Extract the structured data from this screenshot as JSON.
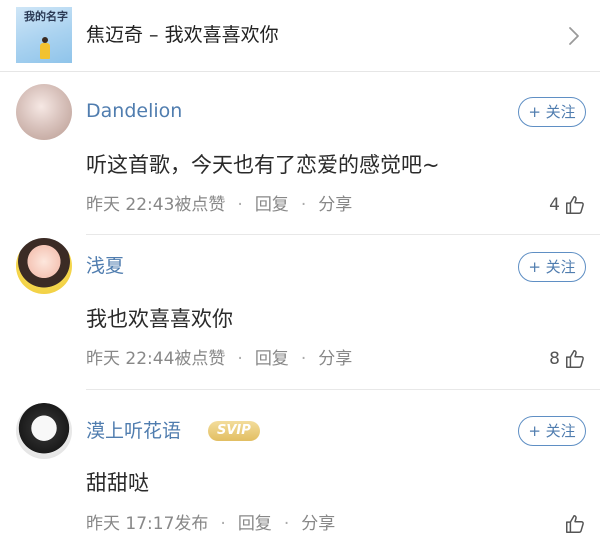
{
  "song": {
    "title": "焦迈奇 – 我欢喜喜欢你",
    "cover_text": "我的名字"
  },
  "comments": [
    {
      "username": "Dandelion",
      "text": "听这首歌，今天也有了恋爱的感觉吧~",
      "time": "昨天 22:43",
      "status": "被点赞",
      "reply_label": "回复",
      "share_label": "分享",
      "likes": "4",
      "follow_label": "+ 关注"
    },
    {
      "username": "浅夏",
      "text": "我也欢喜喜欢你",
      "time": "昨天 22:44",
      "status": "被点赞",
      "reply_label": "回复",
      "share_label": "分享",
      "likes": "8",
      "follow_label": "+ 关注"
    },
    {
      "username": "漠上听花语",
      "badge": "SVIP",
      "text": "甜甜哒",
      "time": "昨天 17:17",
      "status": "发布",
      "reply_label": "回复",
      "share_label": "分享",
      "likes": "",
      "follow_label": "+ 关注"
    }
  ],
  "separator": "·",
  "colors": {
    "username": "#507daf",
    "follow_border": "#5f8fc4",
    "svip_gold": "#e2be62",
    "meta_text": "#888888"
  },
  "icons": [
    "album-cover",
    "chevron-right-icon",
    "thumbs-up-icon"
  ]
}
